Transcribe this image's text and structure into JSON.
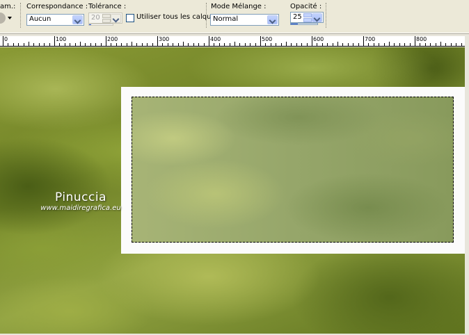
{
  "toolbar": {
    "cut_label": "am.:",
    "match_mode": {
      "label": "Correspondance :",
      "value": "Aucun"
    },
    "tolerance": {
      "label": "Tolérance :",
      "value": "20"
    },
    "use_all_layers": {
      "label": "Utiliser tous les calques",
      "checked": false
    },
    "blend_mode": {
      "label": "Mode Mélange :",
      "value": "Normal"
    },
    "opacity": {
      "label": "Opacité :",
      "value": "25",
      "fraction": 0.25
    }
  },
  "ruler": {
    "labels": [
      "0",
      "100",
      "200",
      "300",
      "400",
      "500",
      "600",
      "700",
      "800"
    ]
  },
  "canvas": {
    "watermark": {
      "name": "Pinuccia",
      "url": "www.maidiregrafica.eu"
    }
  },
  "colors": {
    "toolbar_bg": "#ece9d8",
    "combo_border": "#7f9db9",
    "progress_fill": "#2c5ad8",
    "frame_white": "#fbfbfb"
  }
}
